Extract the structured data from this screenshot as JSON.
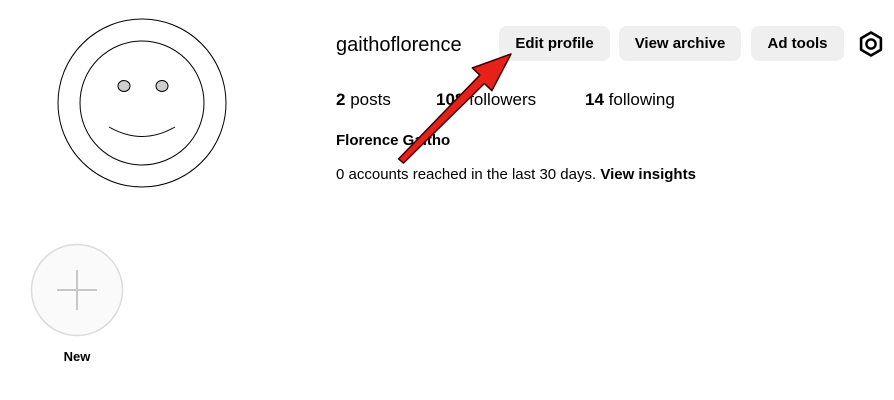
{
  "profile": {
    "username": "gaithoflorence",
    "full_name": "Florence Gaitho"
  },
  "buttons": {
    "edit_profile": "Edit profile",
    "view_archive": "View archive",
    "ad_tools": "Ad tools"
  },
  "stats": {
    "posts_count": "2",
    "posts_label": " posts",
    "followers_count": "108",
    "followers_label": " followers",
    "following_count": "14",
    "following_label": " following"
  },
  "insights": {
    "reach_text": "0 accounts reached in the last 30 days. ",
    "link_label": "View insights"
  },
  "highlights": {
    "new_label": "New"
  },
  "icons": {
    "avatar": "smiley-face-avatar-icon",
    "settings": "gear-icon",
    "new_highlight": "plus-icon",
    "annotation": "red-arrow-icon"
  },
  "colors": {
    "button_bg": "#efefef",
    "annotation_arrow": "#e8201a",
    "highlight_ring": "#dbdbdb"
  }
}
